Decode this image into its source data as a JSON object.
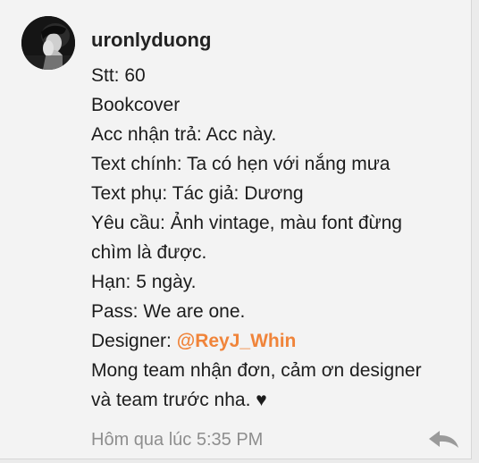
{
  "post": {
    "username": "uronlyduong",
    "lines": {
      "stt": "Stt: 60",
      "type": "Bookcover",
      "acc": "Acc nhận trả: Acc này.",
      "text_main": "Text chính: Ta có hẹn với nắng mưa",
      "text_sub": "Text phụ: Tác giả: Dương",
      "request_1": "Yêu cầu: Ảnh vintage, màu font đừng",
      "request_2": "chìm là được.",
      "deadline": "Hạn: 5 ngày.",
      "pass": "Pass: We are one.",
      "designer_label": "Designer: ",
      "designer_mention": "@ReyJ_Whin",
      "closing_1": "Mong team nhận đơn, cảm ơn designer",
      "closing_2": "và team trước nha. ♥"
    },
    "timestamp": "Hôm qua lúc 5:35 PM"
  },
  "colors": {
    "mention": "#f0843a",
    "timestamp": "#8e8e8e",
    "background": "#f3f3f3"
  },
  "icons": {
    "avatar": "avatar-photo",
    "reply": "reply-arrow-icon"
  }
}
